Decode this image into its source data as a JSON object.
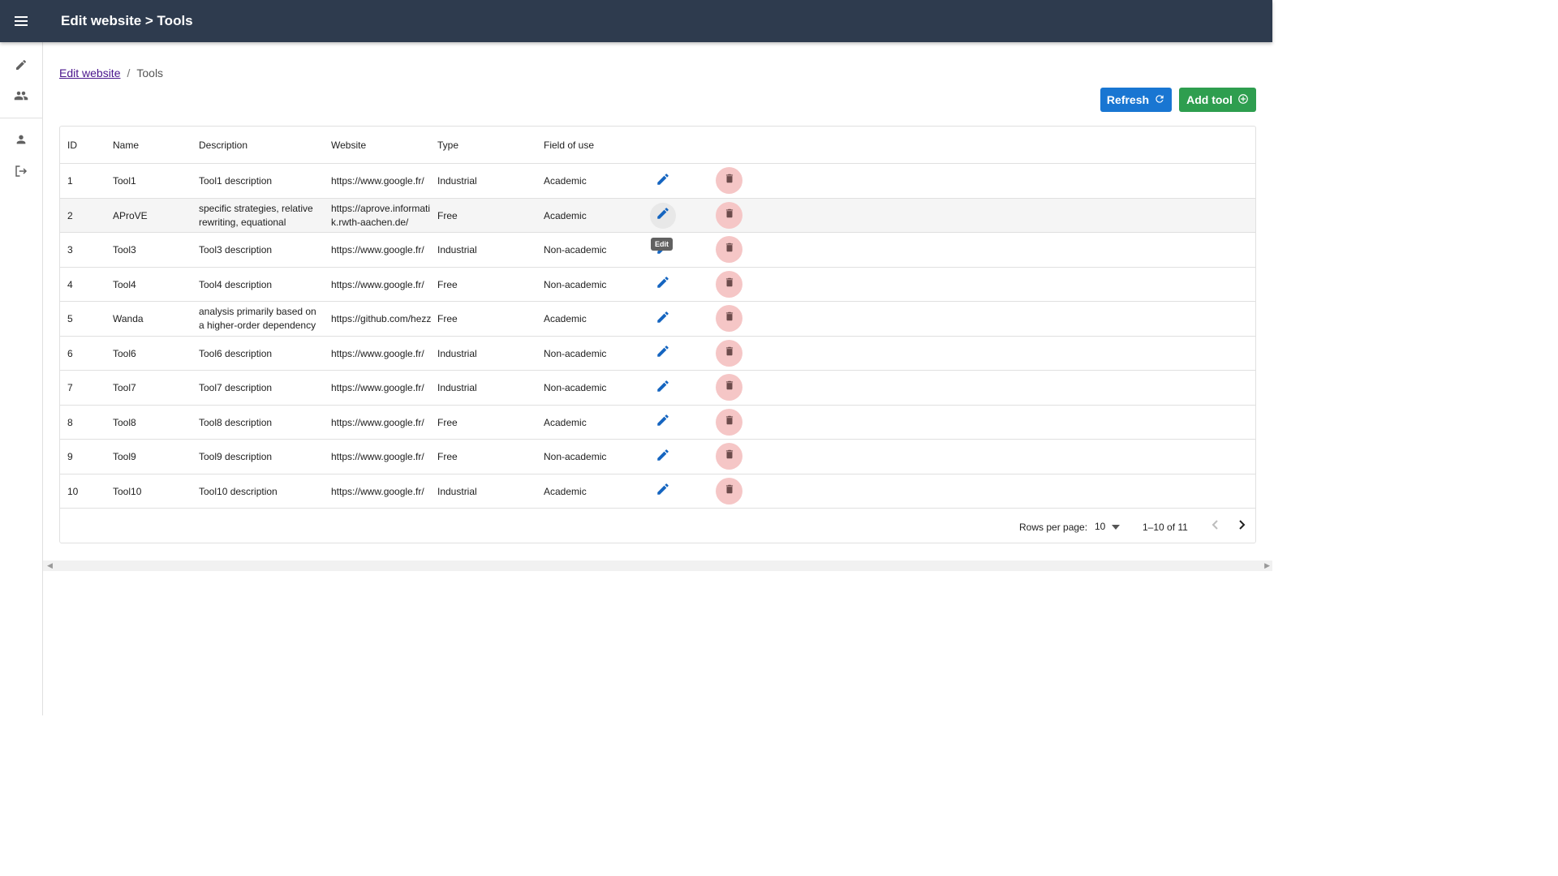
{
  "header": {
    "title": "Edit website > Tools"
  },
  "sidebar": {
    "items": [
      "edit-icon",
      "group-icon",
      "person-icon",
      "logout-icon"
    ]
  },
  "breadcrumb": {
    "link": "Edit website",
    "separator": "/",
    "current": "Tools"
  },
  "toolbar": {
    "refresh_label": "Refresh",
    "add_label": "Add tool"
  },
  "table": {
    "columns": [
      "ID",
      "Name",
      "Description",
      "Website",
      "Type",
      "Field of use"
    ],
    "rows": [
      {
        "id": "1",
        "name": "Tool1",
        "description": "Tool1 description",
        "website": "https://www.google.fr/",
        "type": "Industrial",
        "field": "Academic"
      },
      {
        "id": "2",
        "name": "AProVE",
        "description": "specific strategies, relative rewriting, equational",
        "website": "https://aprove.informatik.rwth-aachen.de/",
        "type": "Free",
        "field": "Academic"
      },
      {
        "id": "3",
        "name": "Tool3",
        "description": "Tool3 description",
        "website": "https://www.google.fr/",
        "type": "Industrial",
        "field": "Non-academic"
      },
      {
        "id": "4",
        "name": "Tool4",
        "description": "Tool4 description",
        "website": "https://www.google.fr/",
        "type": "Free",
        "field": "Non-academic"
      },
      {
        "id": "5",
        "name": "Wanda",
        "description": "analysis primarily based on a higher-order dependency",
        "website": "https://github.com/hezzel",
        "type": "Free",
        "field": "Academic"
      },
      {
        "id": "6",
        "name": "Tool6",
        "description": "Tool6 description",
        "website": "https://www.google.fr/",
        "type": "Industrial",
        "field": "Non-academic"
      },
      {
        "id": "7",
        "name": "Tool7",
        "description": "Tool7 description",
        "website": "https://www.google.fr/",
        "type": "Industrial",
        "field": "Non-academic"
      },
      {
        "id": "8",
        "name": "Tool8",
        "description": "Tool8 description",
        "website": "https://www.google.fr/",
        "type": "Free",
        "field": "Academic"
      },
      {
        "id": "9",
        "name": "Tool9",
        "description": "Tool9 description",
        "website": "https://www.google.fr/",
        "type": "Free",
        "field": "Non-academic"
      },
      {
        "id": "10",
        "name": "Tool10",
        "description": "Tool10 description",
        "website": "https://www.google.fr/",
        "type": "Industrial",
        "field": "Academic"
      }
    ]
  },
  "tooltip": {
    "text": "Edit"
  },
  "pagination": {
    "rows_label": "Rows per page:",
    "rows_value": "10",
    "range": "1–10 of 11"
  },
  "colors": {
    "appbar": "#2e3b4e",
    "refresh": "#1976d2",
    "add": "#2e9e4f",
    "edit_icon": "#1565c0",
    "delete_bg": "#f5c6c6",
    "delete_icon": "#6d4c4c"
  }
}
